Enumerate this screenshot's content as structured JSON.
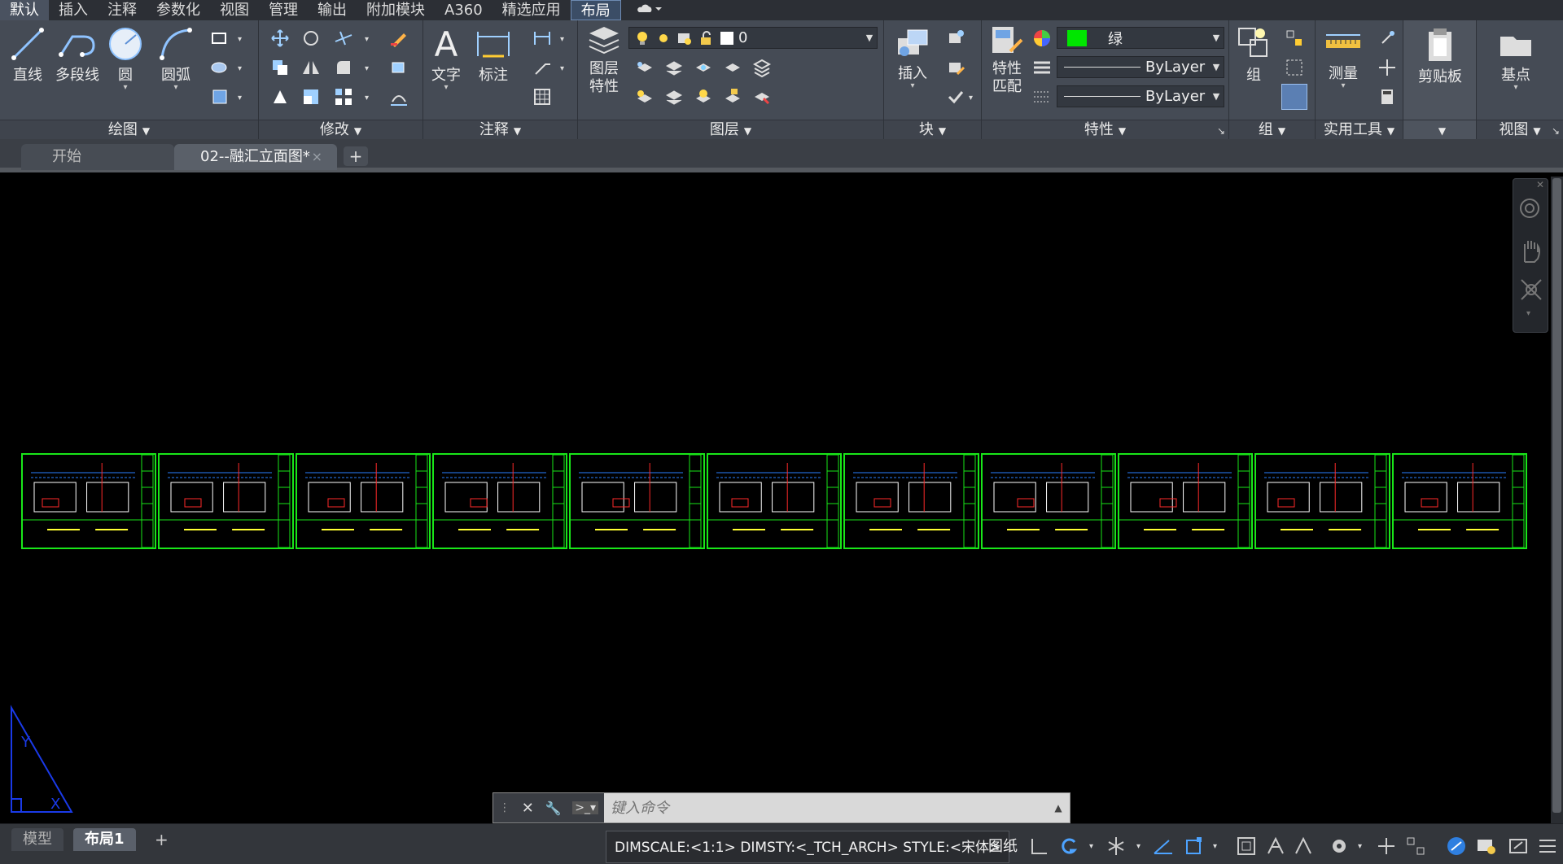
{
  "menubar": {
    "tabs": [
      "默认",
      "插入",
      "注释",
      "参数化",
      "视图",
      "管理",
      "输出",
      "附加模块",
      "A360",
      "精选应用",
      "布局"
    ],
    "active": "默认",
    "cloud_icon": "cloud-icon"
  },
  "ribbon": {
    "draw": {
      "title": "绘图",
      "line": "直线",
      "polyline": "多段线",
      "circle": "圆",
      "arc": "圆弧"
    },
    "modify": {
      "title": "修改"
    },
    "annotation": {
      "title": "注释",
      "text": "文字",
      "dimension": "标注"
    },
    "layers": {
      "title": "图层",
      "layer_props_line1": "图层",
      "layer_props_line2": "特性",
      "current_layer": "0"
    },
    "block": {
      "title": "块",
      "insert": "插入"
    },
    "properties": {
      "title": "特性",
      "match_line1": "特性",
      "match_line2": "匹配",
      "color": "绿",
      "color_hex": "#00e600",
      "linetype": "ByLayer",
      "lineweight": "ByLayer"
    },
    "groups": {
      "title": "组",
      "group": "组"
    },
    "utilities": {
      "title": "实用工具",
      "measure": "测量"
    },
    "clipboard": {
      "clipboard": "剪贴板"
    },
    "view": {
      "title": "视图",
      "basepoint": "基点"
    }
  },
  "doctabs": {
    "start": "开始",
    "drawing": "02--融汇立面图*",
    "close": "×",
    "add": "+"
  },
  "command": {
    "placeholder": "键入命令",
    "close": "✕",
    "settings": "🔧"
  },
  "statusbar": {
    "model": "模型",
    "layout1": "布局1",
    "add": "+",
    "dim_info": "DIMSCALE:<1:1> DIMSTY:<_TCH_ARCH> STYLE:<宋体>",
    "paper": "图纸"
  },
  "sheets_count": 11
}
